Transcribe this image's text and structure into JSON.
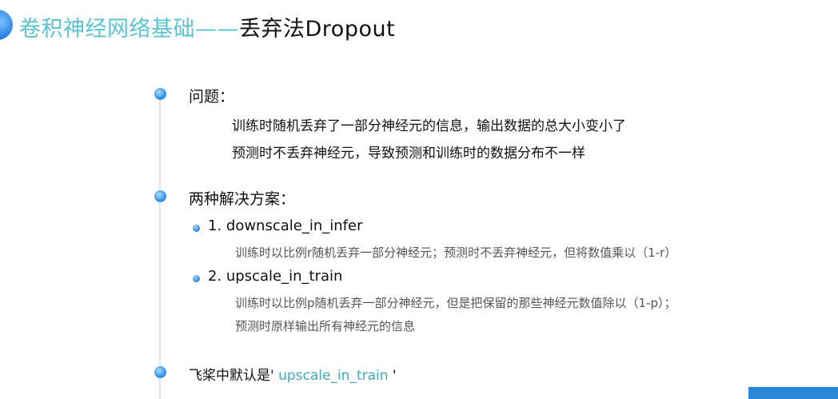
{
  "title": {
    "main": "卷积神经网络基础",
    "separator": "——",
    "sub": "丢弃法Dropout"
  },
  "sections": {
    "problem": {
      "heading": "问题：",
      "lines": [
        "训练时随机丢弃了一部分神经元的信息，输出数据的总大小变小了",
        "预测时不丢弃神经元，导致预测和训练时的数据分布不一样"
      ]
    },
    "solutions": {
      "heading": "两种解决方案：",
      "items": [
        {
          "label": "1.  downscale_in_infer",
          "desc": [
            "训练时以比例r随机丢弃一部分神经元；预测时不丢弃神经元，但将数值乘以（1-r）"
          ]
        },
        {
          "label": "2.  upscale_in_train",
          "desc": [
            "训练时以比例p随机丢弃一部分神经元，但是把保留的那些神经元数值除以（1-p）；",
            "预测时原样输出所有神经元的信息"
          ]
        }
      ]
    },
    "default": {
      "prefix": "飞桨中默认是'",
      "value": " upscale_in_train",
      "suffix": " '"
    }
  },
  "colors": {
    "title_accent": "#5ac3cf",
    "bullet": "#3a9ae8",
    "highlight": "#3fa7b8"
  }
}
